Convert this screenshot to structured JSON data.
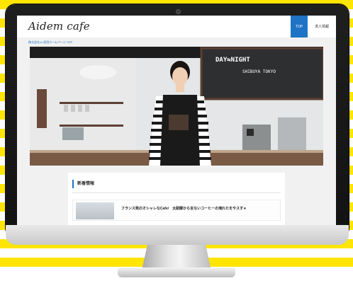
{
  "site": {
    "logo": "Aidem cafe",
    "breadcrumb": "株式会社xx 採用ホームページ TOP"
  },
  "nav": {
    "items": [
      {
        "label": "TOP",
        "active": true
      },
      {
        "label": "求人情報",
        "active": false
      }
    ]
  },
  "hero": {
    "chalkboard": {
      "title": "DAY⇆NIGHT",
      "subtitle": "SHIBUYA TOKYO"
    }
  },
  "news": {
    "heading": "新着情報",
    "items": [
      {
        "text": "フランス発のオシャレなCafe/　太耐脚から言ないコーヒーの淹れたをやスす★"
      }
    ]
  },
  "colors": {
    "accent": "#1f73c4",
    "stripe": "#ffe500",
    "bezel": "#161616"
  }
}
